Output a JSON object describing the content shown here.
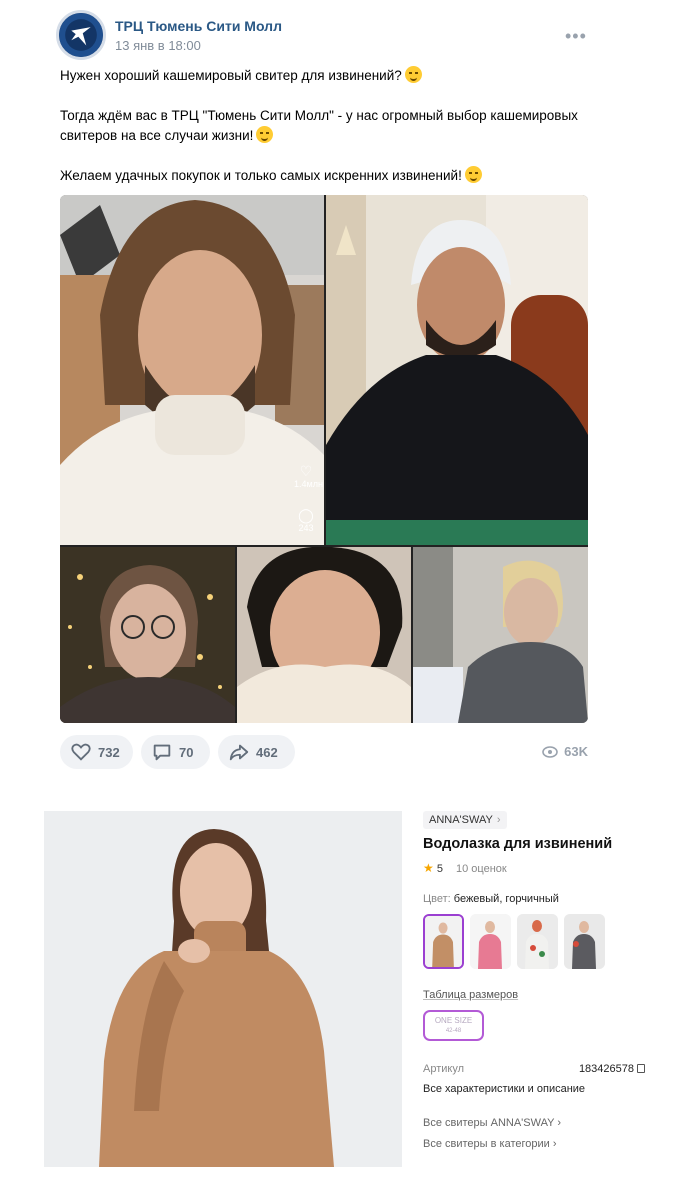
{
  "post": {
    "author": "ТРЦ Тюмень Сити Молл",
    "date": "13 янв в 18:00",
    "more": "•••",
    "text": {
      "line1": "Нужен хороший кашемировый свитер для извинений?",
      "line2": "Тогда ждём вас в ТРЦ \"Тюмень Сити Молл\" - у нас огромный выбор кашемировых свитеров на все случаи жизни!",
      "line3": "Желаем удачных покупок и только самых искренних извинений!"
    },
    "media_overlay": {
      "likes": "1.4млн",
      "comments": "243"
    },
    "actions": {
      "likes": "732",
      "comments": "70",
      "shares": "462",
      "views": "63K"
    },
    "icons": [
      "heart-icon",
      "comment-icon",
      "share-icon",
      "eye-icon"
    ]
  },
  "product": {
    "brand": "ANNA'SWAY",
    "brand_chevron": "›",
    "title": "Водолазка для извинений",
    "rating_star": "★",
    "rating": "5",
    "reviews": "10 оценок",
    "color_label": "Цвет:",
    "color_value": "бежевый, горчичный",
    "size_table": "Таблица размеров",
    "size_option": "ONE SIZE",
    "size_sub": "42-48",
    "article_label": "Артикул",
    "article_value": "183426578",
    "all_characteristics": "Все характеристики и описание",
    "link_brand": "Все свитеры ANNA'SWAY",
    "link_category": "Все свитеры в категории",
    "chevron": "›",
    "colors": {
      "accent": "#9b3fd1",
      "star": "#f7a600"
    }
  },
  "colors": {
    "vk_link": "#2a5885",
    "muted": "#818c99",
    "pill_bg": "#f0f2f5"
  }
}
